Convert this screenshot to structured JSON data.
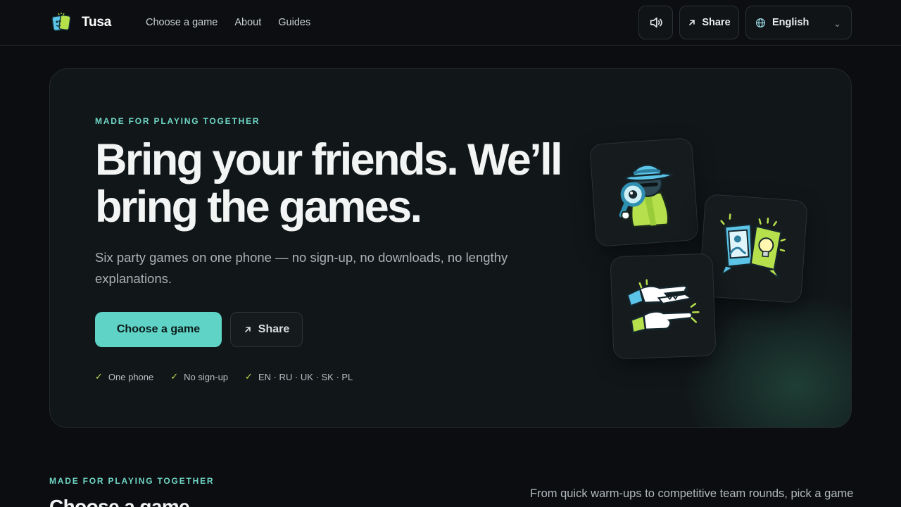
{
  "header": {
    "brand": "Tusa",
    "nav": [
      {
        "label": "Choose a game"
      },
      {
        "label": "About"
      },
      {
        "label": "Guides"
      }
    ],
    "share_label": "Share",
    "language": "English"
  },
  "hero": {
    "eyebrow": "MADE FOR PLAYING TOGETHER",
    "title_line1": "Bring your friends. We’ll",
    "title_line2": "bring the games.",
    "subtitle": "Six party games on one phone — no sign-up, no downloads, no lengthy explanations.",
    "primary_cta": "Choose a game",
    "secondary_cta": "Share",
    "features": [
      {
        "label": "One phone"
      },
      {
        "label": "No sign-up"
      },
      {
        "label": "EN · RU · UK · SK · PL"
      }
    ]
  },
  "section": {
    "eyebrow": "MADE FOR PLAYING TOGETHER",
    "title": "Choose a game",
    "description": "From quick warm-ups to competitive team rounds, pick a game"
  },
  "colors": {
    "background": "#0b0d10",
    "accent": "#5fd3c6",
    "eyebrow": "#6fd6c6",
    "check": "#b6e04c"
  },
  "icons": [
    "speaker-icon",
    "arrow-up-right-icon",
    "globe-icon",
    "chevron-down-icon",
    "check-icon"
  ]
}
